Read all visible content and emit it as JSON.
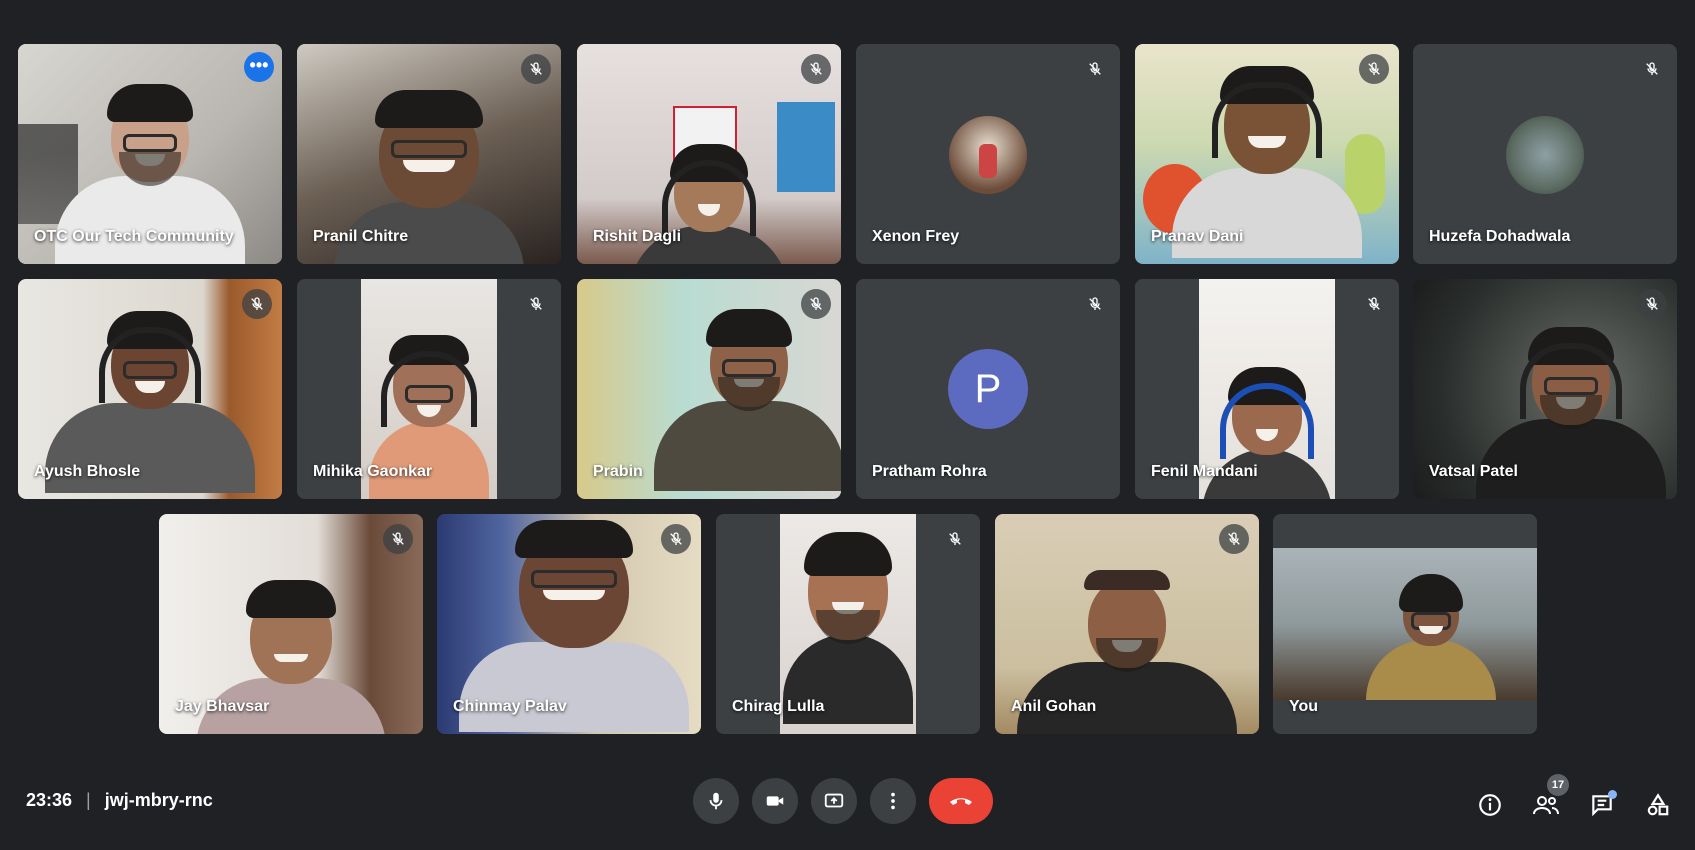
{
  "participants": [
    {
      "name": "OTC Our Tech Community"
    },
    {
      "name": "Pranil Chitre"
    },
    {
      "name": "Rishit Dagli"
    },
    {
      "name": "Xenon Frey"
    },
    {
      "name": "Pranav Dani"
    },
    {
      "name": "Huzefa Dohadwala"
    },
    {
      "name": "Ayush Bhosle"
    },
    {
      "name": "Mihika Gaonkar"
    },
    {
      "name": "Prabin"
    },
    {
      "name": "Pratham Rohra",
      "initial": "P"
    },
    {
      "name": "Fenil Mandani"
    },
    {
      "name": "Vatsal Patel"
    },
    {
      "name": "Jay Bhavsar"
    },
    {
      "name": "Chinmay Palav"
    },
    {
      "name": "Chirag Lulla"
    },
    {
      "name": "Anil Gohan"
    },
    {
      "name": "You"
    }
  ],
  "tile_more_options": "•••",
  "meeting": {
    "time": "23:36",
    "separator": "|",
    "code": "jwj-mbry-rnc"
  },
  "people_count": "17",
  "colors": {
    "background": "#202124",
    "tile": "#3c4043",
    "active_outline": "#8ab4f8",
    "end_call": "#ea4335",
    "avatar_letter_bg": "#5c6bc0"
  }
}
